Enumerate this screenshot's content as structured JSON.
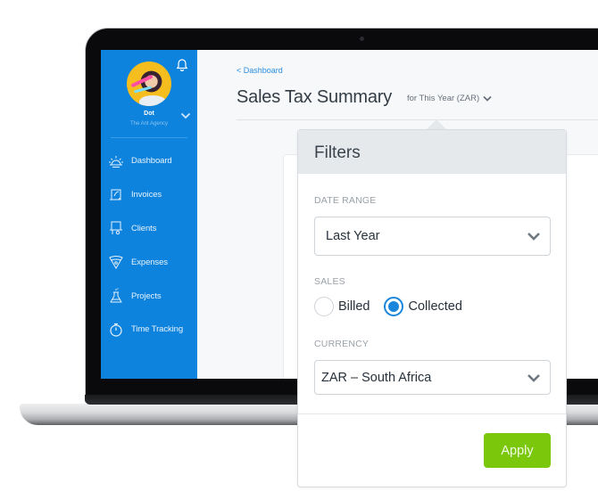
{
  "sidebar": {
    "user": {
      "name": "Dot",
      "organization": "The Ant Agency"
    },
    "items": [
      {
        "label": "Dashboard",
        "icon": "sunrise-icon"
      },
      {
        "label": "Invoices",
        "icon": "scroll-icon"
      },
      {
        "label": "Clients",
        "icon": "client-desk-icon"
      },
      {
        "label": "Expenses",
        "icon": "pizza-slice-icon"
      },
      {
        "label": "Projects",
        "icon": "flask-icon"
      },
      {
        "label": "Time Tracking",
        "icon": "stopwatch-icon"
      }
    ],
    "color": "#0d83dd"
  },
  "main": {
    "breadcrumb": "< Dashboard",
    "title": "Sales Tax Summary",
    "period": "for This Year (ZAR)"
  },
  "filters": {
    "title": "Filters",
    "date_range": {
      "label": "DATE RANGE",
      "value": "Last Year"
    },
    "sales": {
      "label": "SALES",
      "options": [
        {
          "label": "Billed",
          "selected": false
        },
        {
          "label": "Collected",
          "selected": true
        }
      ]
    },
    "currency": {
      "label": "CURRENCY",
      "value": "ZAR – South Africa"
    },
    "apply_label": "Apply",
    "apply_color": "#7ac70c"
  }
}
